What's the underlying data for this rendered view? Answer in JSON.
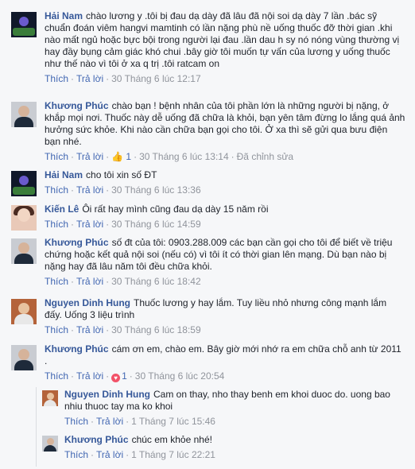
{
  "labels": {
    "like": "Thích",
    "reply": "Trả lời",
    "edited": "Đã chỉnh sửa"
  },
  "comments": [
    {
      "author": "Hải Nam",
      "text": "chào lương y .tôi bị đau dạ dày đã lâu đã nội soi dạ dày 7 lần .bác sỹ chuẩn đoán viêm hangvi mamtinh có lần nặng phù nề uống thuốc đỡ thời gian .khi nào mất ngủ hoặc bực bội trong người lại đau .lần dau h sy nó nóng vùng thường vị hay đầy bụng cảm giác khó chui .bây giờ tôi muốn tự vấn của lương y uống thuốc như thế nào vì tôi ở xa q trị .tôi ratcam on",
      "time": "30 Tháng 6 lúc 12:17"
    },
    {
      "author": "Khương Phúc",
      "text": "chào bạn ! bệnh nhân của tôi phần lớn là những người bị nặng, ở khắp mọi nơi. Thuốc này dễ uống đã chữa là khỏi, bạn yên tâm đừng lo lắng quá ảnh hưởng sức khỏe. Khi nào cần chữa bạn gọi cho tôi. Ở xa thì sẽ gửi qua bưu điện bạn nhé.",
      "likes": "1",
      "time": "30 Tháng 6 lúc 13:14"
    },
    {
      "author": "Hải Nam",
      "text": "cho tôi xin số ĐT",
      "time": "30 Tháng 6 lúc 13:36"
    },
    {
      "author": "Kiến Lê",
      "text": "Ôi rất hay mình cũng đau dạ dày 15 năm rồi",
      "time": "30 Tháng 6 lúc 14:59"
    },
    {
      "author": "Khương Phúc",
      "text": "số đt của tôi: 0903.288.009 các bạn cần gọi cho tôi để biết về triệu chứng hoặc kết quả nội soi (nếu có) vì tôi ít có thời gian lên mạng. Dù bạn nào bị nặng hay đã lâu năm tôi đều chữa khỏi.",
      "time": "30 Tháng 6 lúc 18:42"
    },
    {
      "author": "Nguyen Dinh Hung",
      "text": "Thuốc lương y hay lắm. Tuy liều nhỏ nhưng công mạnh lắm đấy. Uống 3 liệu trình",
      "time": "30 Tháng 6 lúc 18:59"
    },
    {
      "author": "Khương Phúc",
      "text": "cám ơn em, chào em. Bây giờ mới nhớ ra em chữa chỗ anh từ 2011 .",
      "likes": "1",
      "time": "30 Tháng 6 lúc 20:54"
    }
  ],
  "replies": [
    {
      "author": "Nguyen Dinh Hung",
      "text": "Cam on thay, nho thay benh em khoi duoc do. uong bao nhiu thuoc tay ma ko khoi",
      "time": "1 Tháng 7 lúc 15:46"
    },
    {
      "author": "Khương Phúc",
      "text": "chúc em khỏe nhé!",
      "time": "1 Tháng 7 lúc 22:21"
    }
  ]
}
